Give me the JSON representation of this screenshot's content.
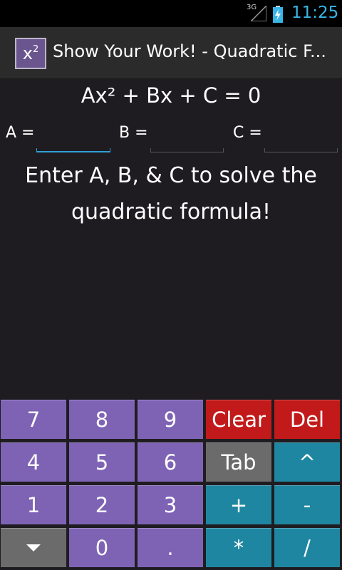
{
  "status_bar": {
    "network_type": "3G",
    "time": "11:25",
    "accent_color": "#39b5e6"
  },
  "action_bar": {
    "icon_text": "x",
    "icon_sup": "2",
    "title": "Show Your Work! - Quadratic F..."
  },
  "equation": "Ax² + Bx + C = 0",
  "inputs": {
    "a_label": "A =",
    "b_label": "B =",
    "c_label": "C =",
    "a_value": "",
    "b_value": "",
    "c_value": ""
  },
  "instruction": {
    "line1": "Enter A, B, & C to solve the",
    "line2": "quadratic formula!"
  },
  "keypad": {
    "rows": [
      [
        {
          "label": "7",
          "color": "#7e63b5"
        },
        {
          "label": "8",
          "color": "#7e63b5"
        },
        {
          "label": "9",
          "color": "#7e63b5"
        },
        {
          "label": "Clear",
          "color": "#c21a1a"
        },
        {
          "label": "Del",
          "color": "#c21a1a"
        }
      ],
      [
        {
          "label": "4",
          "color": "#7e63b5"
        },
        {
          "label": "5",
          "color": "#7e63b5"
        },
        {
          "label": "6",
          "color": "#7e63b5"
        },
        {
          "label": "Tab",
          "color": "#6b6b6b"
        },
        {
          "label": "^",
          "color": "#1e86a0"
        }
      ],
      [
        {
          "label": "1",
          "color": "#7e63b5"
        },
        {
          "label": "2",
          "color": "#7e63b5"
        },
        {
          "label": "3",
          "color": "#7e63b5"
        },
        {
          "label": "+",
          "color": "#1e86a0"
        },
        {
          "label": "-",
          "color": "#1e86a0"
        }
      ],
      [
        {
          "label": "",
          "icon": "arrow-down-icon",
          "color": "#6b6b6b"
        },
        {
          "label": "0",
          "color": "#7e63b5"
        },
        {
          "label": ".",
          "color": "#7e63b5"
        },
        {
          "label": "*",
          "color": "#1e86a0"
        },
        {
          "label": "/",
          "color": "#1e86a0"
        }
      ]
    ]
  }
}
